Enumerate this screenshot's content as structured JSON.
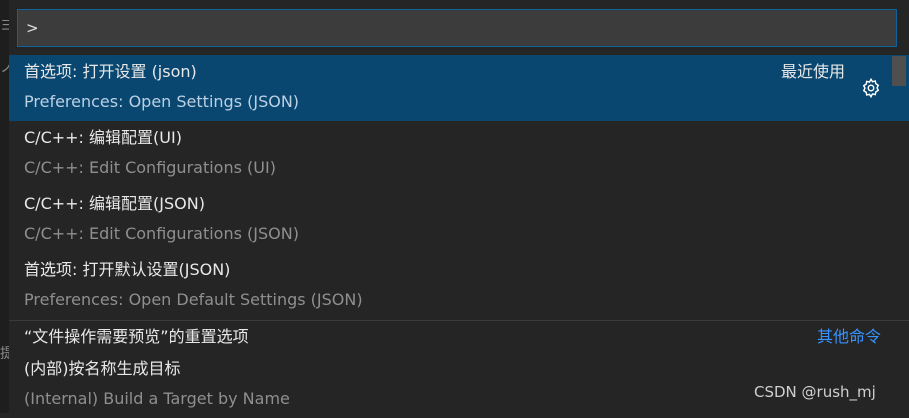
{
  "input": {
    "value": ">"
  },
  "items": [
    {
      "label": "首选项: 打开设置 (json)",
      "detail": "Preferences: Open Settings (JSON)",
      "meta": "最近使用",
      "selected": true,
      "gear_icon": "gear-icon"
    },
    {
      "label": "C/C++: 编辑配置(UI)",
      "detail": "C/C++: Edit Configurations (UI)"
    },
    {
      "label": "C/C++: 编辑配置(JSON)",
      "detail": "C/C++: Edit Configurations (JSON)"
    },
    {
      "label": "首选项: 打开默认设置(JSON)",
      "detail": "Preferences: Open Default Settings (JSON)"
    },
    {
      "label": "“文件操作需要预览”的重置选项",
      "link": "其他命令"
    },
    {
      "label": "(内部)按名称生成目标",
      "detail": "(Internal) Build a Target by Name"
    }
  ],
  "edge_glyphs": [
    "ヨ",
    "ノ",
    "提"
  ],
  "watermark": "CSDN @rush_mj",
  "colors": {
    "selected_bg": "#094771",
    "link": "#3794ff",
    "focus_border": "#0e639c"
  }
}
